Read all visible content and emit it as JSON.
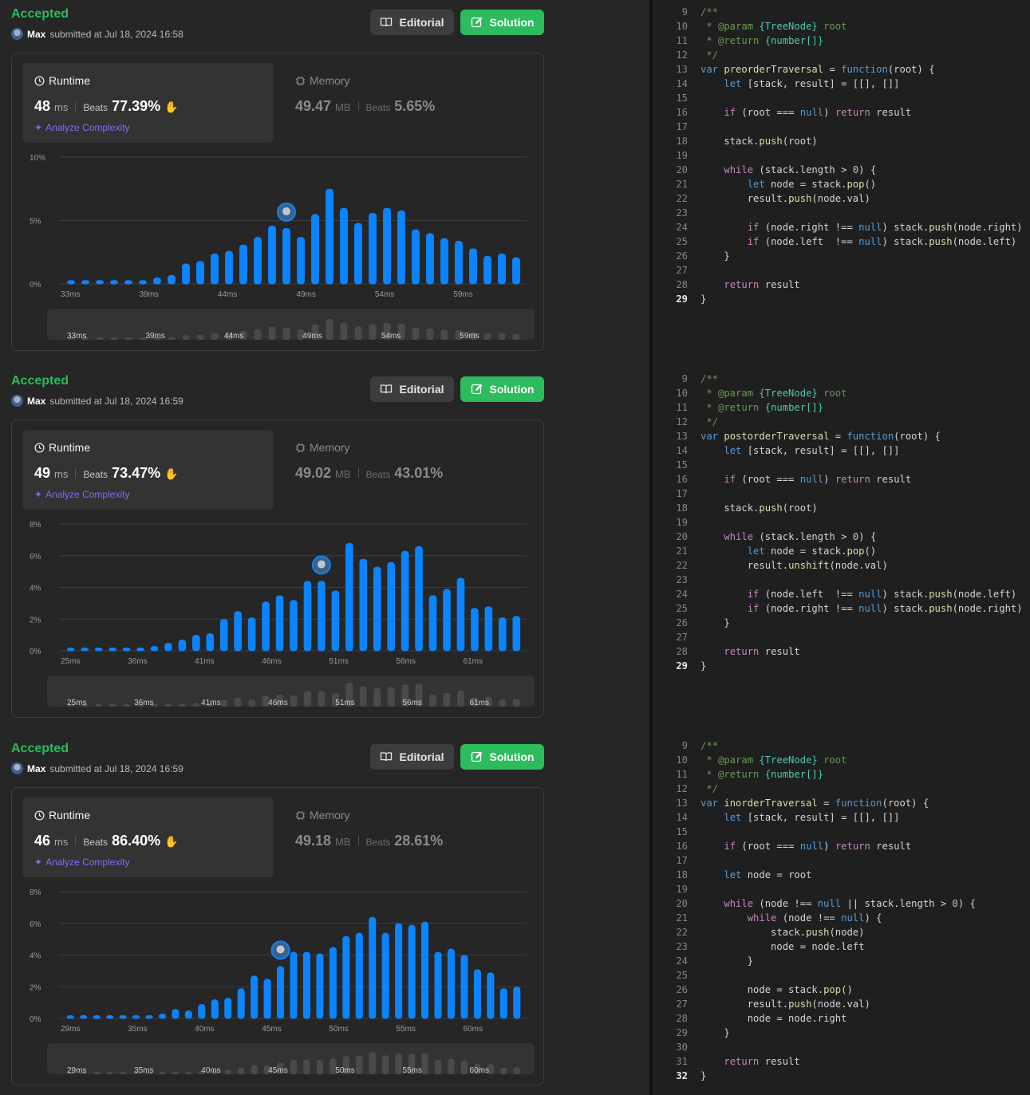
{
  "submissions": [
    {
      "status": "Accepted",
      "user": "Max",
      "submitted_text": "submitted at Jul 18, 2024 16:58",
      "editorial_label": "Editorial",
      "solution_label": "Solution",
      "runtime": {
        "label": "Runtime",
        "value": "48",
        "unit": "ms",
        "beats_label": "Beats",
        "beats": "77.39%"
      },
      "memory": {
        "label": "Memory",
        "value": "49.47",
        "unit": "MB",
        "beats_label": "Beats",
        "beats": "5.65%"
      },
      "analyze_label": "Analyze Complexity",
      "chart_data": {
        "type": "bar",
        "yticks": [
          "10%",
          "5%",
          "0%"
        ],
        "ylim": [
          0,
          10
        ],
        "xticks": [
          "33ms",
          "39ms",
          "44ms",
          "49ms",
          "54ms",
          "59ms"
        ],
        "values": [
          0.3,
          0.3,
          0.3,
          0.3,
          0.3,
          0.3,
          0.5,
          0.7,
          1.6,
          1.8,
          2.4,
          2.6,
          3.1,
          3.7,
          4.6,
          4.4,
          3.7,
          5.5,
          7.5,
          6.0,
          4.8,
          5.6,
          6.0,
          5.8,
          4.3,
          4.0,
          3.6,
          3.4,
          2.8,
          2.2,
          2.4,
          2.1
        ],
        "highlight_index": 15
      },
      "code": {
        "function_name": "preorderTraversal",
        "lines": [
          [
            "9",
            "/**"
          ],
          [
            "10",
            " * @param {TreeNode} root"
          ],
          [
            "11",
            " * @return {number[]}"
          ],
          [
            "12",
            " */"
          ],
          [
            "13",
            "var preorderTraversal = function(root) {"
          ],
          [
            "14",
            "    let [stack, result] = [[], []]"
          ],
          [
            "15",
            ""
          ],
          [
            "16",
            "    if (root === null) return result"
          ],
          [
            "17",
            ""
          ],
          [
            "18",
            "    stack.push(root)"
          ],
          [
            "19",
            ""
          ],
          [
            "20",
            "    while (stack.length > 0) {"
          ],
          [
            "21",
            "        let node = stack.pop()"
          ],
          [
            "22",
            "        result.push(node.val)"
          ],
          [
            "23",
            ""
          ],
          [
            "24",
            "        if (node.right !== null) stack.push(node.right)"
          ],
          [
            "25",
            "        if (node.left  !== null) stack.push(node.left)"
          ],
          [
            "26",
            "    }"
          ],
          [
            "27",
            ""
          ],
          [
            "28",
            "    return result"
          ],
          [
            "29",
            "}"
          ]
        ]
      }
    },
    {
      "status": "Accepted",
      "user": "Max",
      "submitted_text": "submitted at Jul 18, 2024 16:59",
      "editorial_label": "Editorial",
      "solution_label": "Solution",
      "runtime": {
        "label": "Runtime",
        "value": "49",
        "unit": "ms",
        "beats_label": "Beats",
        "beats": "73.47%"
      },
      "memory": {
        "label": "Memory",
        "value": "49.02",
        "unit": "MB",
        "beats_label": "Beats",
        "beats": "43.01%"
      },
      "analyze_label": "Analyze Complexity",
      "chart_data": {
        "type": "bar",
        "yticks": [
          "8%",
          "6%",
          "4%",
          "2%",
          "0%"
        ],
        "ylim": [
          0,
          8
        ],
        "xticks": [
          "25ms",
          "36ms",
          "41ms",
          "46ms",
          "51ms",
          "56ms",
          "61ms"
        ],
        "values": [
          0.2,
          0.2,
          0.2,
          0.2,
          0.2,
          0.2,
          0.3,
          0.5,
          0.7,
          1.0,
          1.1,
          2.0,
          2.5,
          2.1,
          3.1,
          3.5,
          3.2,
          4.4,
          4.4,
          3.8,
          6.8,
          5.8,
          5.3,
          5.6,
          6.3,
          6.6,
          3.5,
          3.9,
          4.6,
          2.7,
          2.8,
          2.1,
          2.2
        ],
        "highlight_index": 18
      },
      "code": {
        "function_name": "postorderTraversal",
        "lines": [
          [
            "9",
            "/**"
          ],
          [
            "10",
            " * @param {TreeNode} root"
          ],
          [
            "11",
            " * @return {number[]}"
          ],
          [
            "12",
            " */"
          ],
          [
            "13",
            "var postorderTraversal = function(root) {"
          ],
          [
            "14",
            "    let [stack, result] = [[], []]"
          ],
          [
            "15",
            ""
          ],
          [
            "16",
            "    if (root === null) return result"
          ],
          [
            "17",
            ""
          ],
          [
            "18",
            "    stack.push(root)"
          ],
          [
            "19",
            ""
          ],
          [
            "20",
            "    while (stack.length > 0) {"
          ],
          [
            "21",
            "        let node = stack.pop()"
          ],
          [
            "22",
            "        result.unshift(node.val)"
          ],
          [
            "23",
            ""
          ],
          [
            "24",
            "        if (node.left  !== null) stack.push(node.left)"
          ],
          [
            "25",
            "        if (node.right !== null) stack.push(node.right)"
          ],
          [
            "26",
            "    }"
          ],
          [
            "27",
            ""
          ],
          [
            "28",
            "    return result"
          ],
          [
            "29",
            "}"
          ]
        ]
      }
    },
    {
      "status": "Accepted",
      "user": "Max",
      "submitted_text": "submitted at Jul 18, 2024 16:59",
      "editorial_label": "Editorial",
      "solution_label": "Solution",
      "runtime": {
        "label": "Runtime",
        "value": "46",
        "unit": "ms",
        "beats_label": "Beats",
        "beats": "86.40%"
      },
      "memory": {
        "label": "Memory",
        "value": "49.18",
        "unit": "MB",
        "beats_label": "Beats",
        "beats": "28.61%"
      },
      "analyze_label": "Analyze Complexity",
      "chart_data": {
        "type": "bar",
        "yticks": [
          "8%",
          "6%",
          "4%",
          "2%",
          "0%"
        ],
        "ylim": [
          0,
          8
        ],
        "xticks": [
          "29ms",
          "35ms",
          "40ms",
          "45ms",
          "50ms",
          "55ms",
          "60ms"
        ],
        "values": [
          0.2,
          0.2,
          0.2,
          0.2,
          0.2,
          0.2,
          0.2,
          0.3,
          0.6,
          0.5,
          0.9,
          1.2,
          1.3,
          1.9,
          2.7,
          2.5,
          3.3,
          4.2,
          4.2,
          4.1,
          4.5,
          5.2,
          5.4,
          6.4,
          5.4,
          6.0,
          5.9,
          6.1,
          4.2,
          4.4,
          4.0,
          3.1,
          2.9,
          1.9,
          2.0
        ],
        "highlight_index": 16
      },
      "code": {
        "function_name": "inorderTraversal",
        "lines": [
          [
            "9",
            "/**"
          ],
          [
            "10",
            " * @param {TreeNode} root"
          ],
          [
            "11",
            " * @return {number[]}"
          ],
          [
            "12",
            " */"
          ],
          [
            "13",
            "var inorderTraversal = function(root) {"
          ],
          [
            "14",
            "    let [stack, result] = [[], []]"
          ],
          [
            "15",
            ""
          ],
          [
            "16",
            "    if (root === null) return result"
          ],
          [
            "17",
            ""
          ],
          [
            "18",
            "    let node = root"
          ],
          [
            "19",
            ""
          ],
          [
            "20",
            "    while (node !== null || stack.length > 0) {"
          ],
          [
            "21",
            "        while (node !== null) {"
          ],
          [
            "22",
            "            stack.push(node)"
          ],
          [
            "23",
            "            node = node.left"
          ],
          [
            "24",
            "        }"
          ],
          [
            "25",
            ""
          ],
          [
            "26",
            "        node = stack.pop()"
          ],
          [
            "27",
            "        result.push(node.val)"
          ],
          [
            "28",
            "        node = node.right"
          ],
          [
            "29",
            "    }"
          ],
          [
            "30",
            ""
          ],
          [
            "31",
            "    return result"
          ],
          [
            "32",
            "}"
          ]
        ]
      }
    }
  ],
  "colors": {
    "accepted": "#2cbb5d",
    "bar": "#0a84ff",
    "overview_bar": "#4a4a4a",
    "analyze": "#7d6df7"
  },
  "icons": {
    "editorial": "book-icon",
    "solution": "edit-icon",
    "runtime": "clock-icon",
    "memory": "chip-icon",
    "analyze": "sparkle-icon",
    "beats": "clap-icon"
  }
}
